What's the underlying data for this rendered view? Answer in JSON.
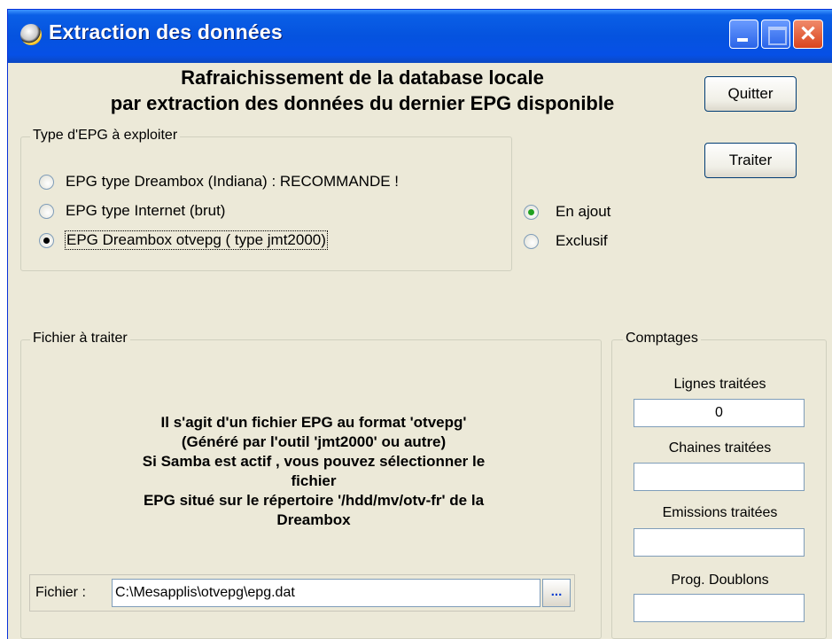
{
  "window": {
    "title": "Extraction des données",
    "accent_color": "#0553df"
  },
  "header": {
    "line1": "Rafraichissement de la database locale",
    "line2": "par extraction des données du dernier EPG disponible"
  },
  "buttons": {
    "quit": "Quitter",
    "process": "Traiter"
  },
  "epg_type": {
    "legend": "Type d'EPG à exploiter",
    "options": [
      {
        "label": "EPG type Dreambox (Indiana) : RECOMMANDE !",
        "selected": false
      },
      {
        "label": "EPG type Internet (brut)",
        "selected": false
      },
      {
        "label": "EPG Dreambox otvepg ( type jmt2000)",
        "selected": true
      }
    ]
  },
  "mode": {
    "options": [
      {
        "label": "En ajout",
        "selected": true
      },
      {
        "label": "Exclusif",
        "selected": false
      }
    ]
  },
  "file_group": {
    "legend": "Fichier à traiter",
    "info_lines": [
      "Il s'agit d'un fichier EPG au format 'otvepg'",
      "(Généré par l'outil 'jmt2000' ou autre)",
      "Si Samba est actif , vous pouvez sélectionner le",
      "fichier",
      "EPG situé sur le répertoire '/hdd/mv/otv-fr' de la",
      "Dreambox"
    ],
    "file_label": "Fichier :",
    "file_value": "C:\\Mesapplis\\otvepg\\epg.dat",
    "browse_label": "..."
  },
  "counts": {
    "legend": "Comptages",
    "items": [
      {
        "label": "Lignes traitées",
        "value": "0"
      },
      {
        "label": "Chaines traitées",
        "value": ""
      },
      {
        "label": "Emissions traitées",
        "value": ""
      },
      {
        "label": "Prog. Doublons",
        "value": ""
      }
    ]
  }
}
